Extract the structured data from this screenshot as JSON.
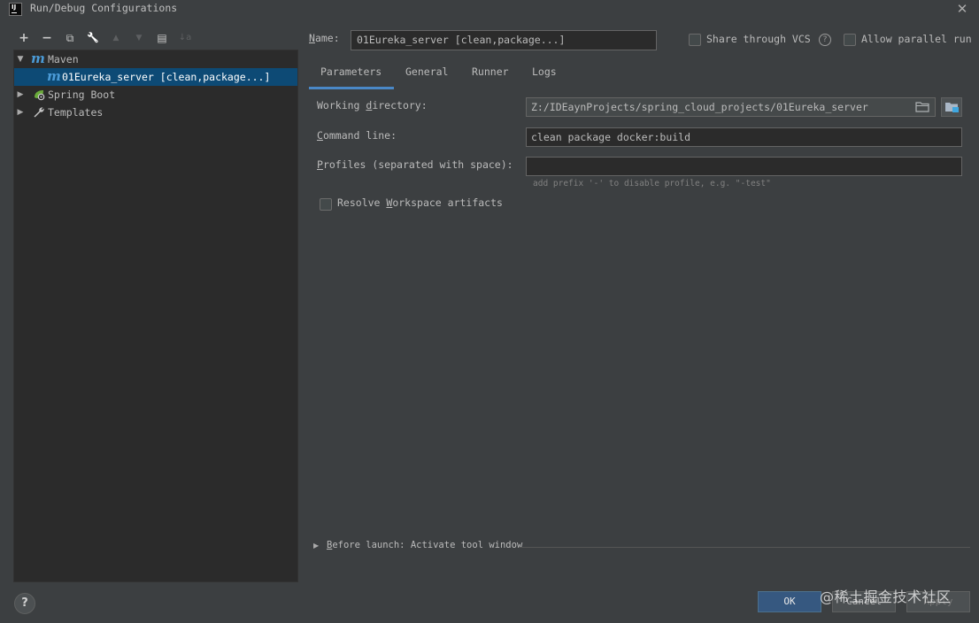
{
  "window": {
    "app_icon": "IJ",
    "title": "Run/Debug Configurations",
    "close_glyph": "✕"
  },
  "toolbar": {
    "add": "+",
    "remove": "−",
    "copy": "⧉",
    "edit_defaults": "🔧",
    "move_up": "▲",
    "move_down": "▼",
    "new_folder": "▤",
    "sort": "↓a"
  },
  "tree": {
    "items": [
      {
        "label": "Maven",
        "icon": "maven-icon",
        "expanded": true
      },
      {
        "label": "01Eureka_server [clean,package...]",
        "icon": "maven-icon",
        "selected": true
      },
      {
        "label": "Spring Boot",
        "icon": "spring-boot-icon",
        "expanded": false
      },
      {
        "label": "Templates",
        "icon": "wrench-icon",
        "expanded": false
      }
    ]
  },
  "header": {
    "name_label": "Name:",
    "name_value": "01Eureka_server [clean,package...]",
    "share_label": "Share through VCS",
    "share_checked": false,
    "help_glyph": "?",
    "parallel_label": "Allow parallel run",
    "parallel_checked": false
  },
  "tabs": [
    {
      "label": "Parameters",
      "active": true
    },
    {
      "label": "General",
      "active": false
    },
    {
      "label": "Runner",
      "active": false
    },
    {
      "label": "Logs",
      "active": false
    }
  ],
  "parameters": {
    "working_directory_label": "Working directory:",
    "working_directory_value": "Z:/IDEaynProjects/spring_cloud_projects/01Eureka_server",
    "command_line_label": "Command line:",
    "command_line_value": "clean package docker:build",
    "profiles_label": "Profiles (separated with space):",
    "profiles_value": "",
    "profiles_hint": "add prefix '-' to disable profile, e.g. \"-test\"",
    "resolve_label": "Resolve Workspace artifacts",
    "resolve_checked": false
  },
  "before_launch": {
    "label": "Before launch: Activate tool window"
  },
  "buttons": {
    "help": "?",
    "ok": "OK",
    "cancel": "Cancel",
    "apply": "Apply"
  },
  "watermark": "@稀土掘金技术社区",
  "colors": {
    "accent": "#4a88c7",
    "selection": "#0d4a75",
    "ok_button": "#365880",
    "maven": "#4b9bd7",
    "spring": "#6aab3a"
  }
}
